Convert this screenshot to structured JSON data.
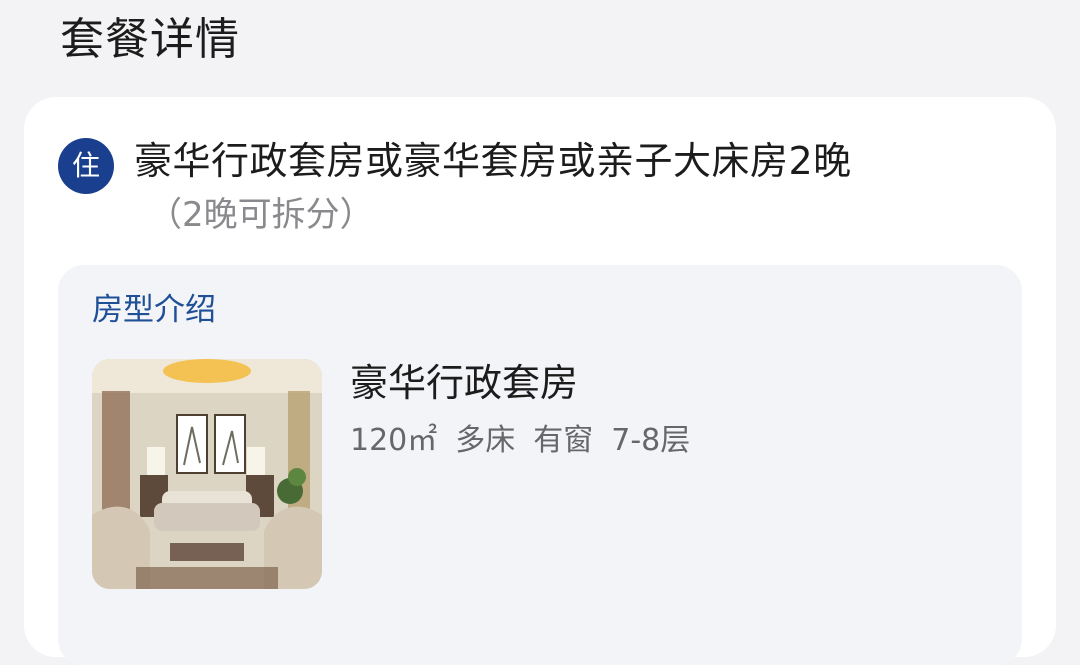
{
  "page": {
    "title": "套餐详情"
  },
  "package": {
    "badge": "住",
    "title": "豪华行政套房或豪华套房或亲子大床房2晚",
    "note": "（2晚可拆分）"
  },
  "room_section": {
    "label": "房型介绍",
    "room": {
      "name": "豪华行政套房",
      "specs": {
        "area": "120㎡",
        "bed": "多床",
        "window": "有窗",
        "floor": "7-8层"
      }
    }
  },
  "colors": {
    "badge_background": "#1a3f8f",
    "section_label": "#1f4f96"
  },
  "icons": {
    "stay_badge": "stay-badge-icon",
    "room_photo": "room-photo"
  }
}
